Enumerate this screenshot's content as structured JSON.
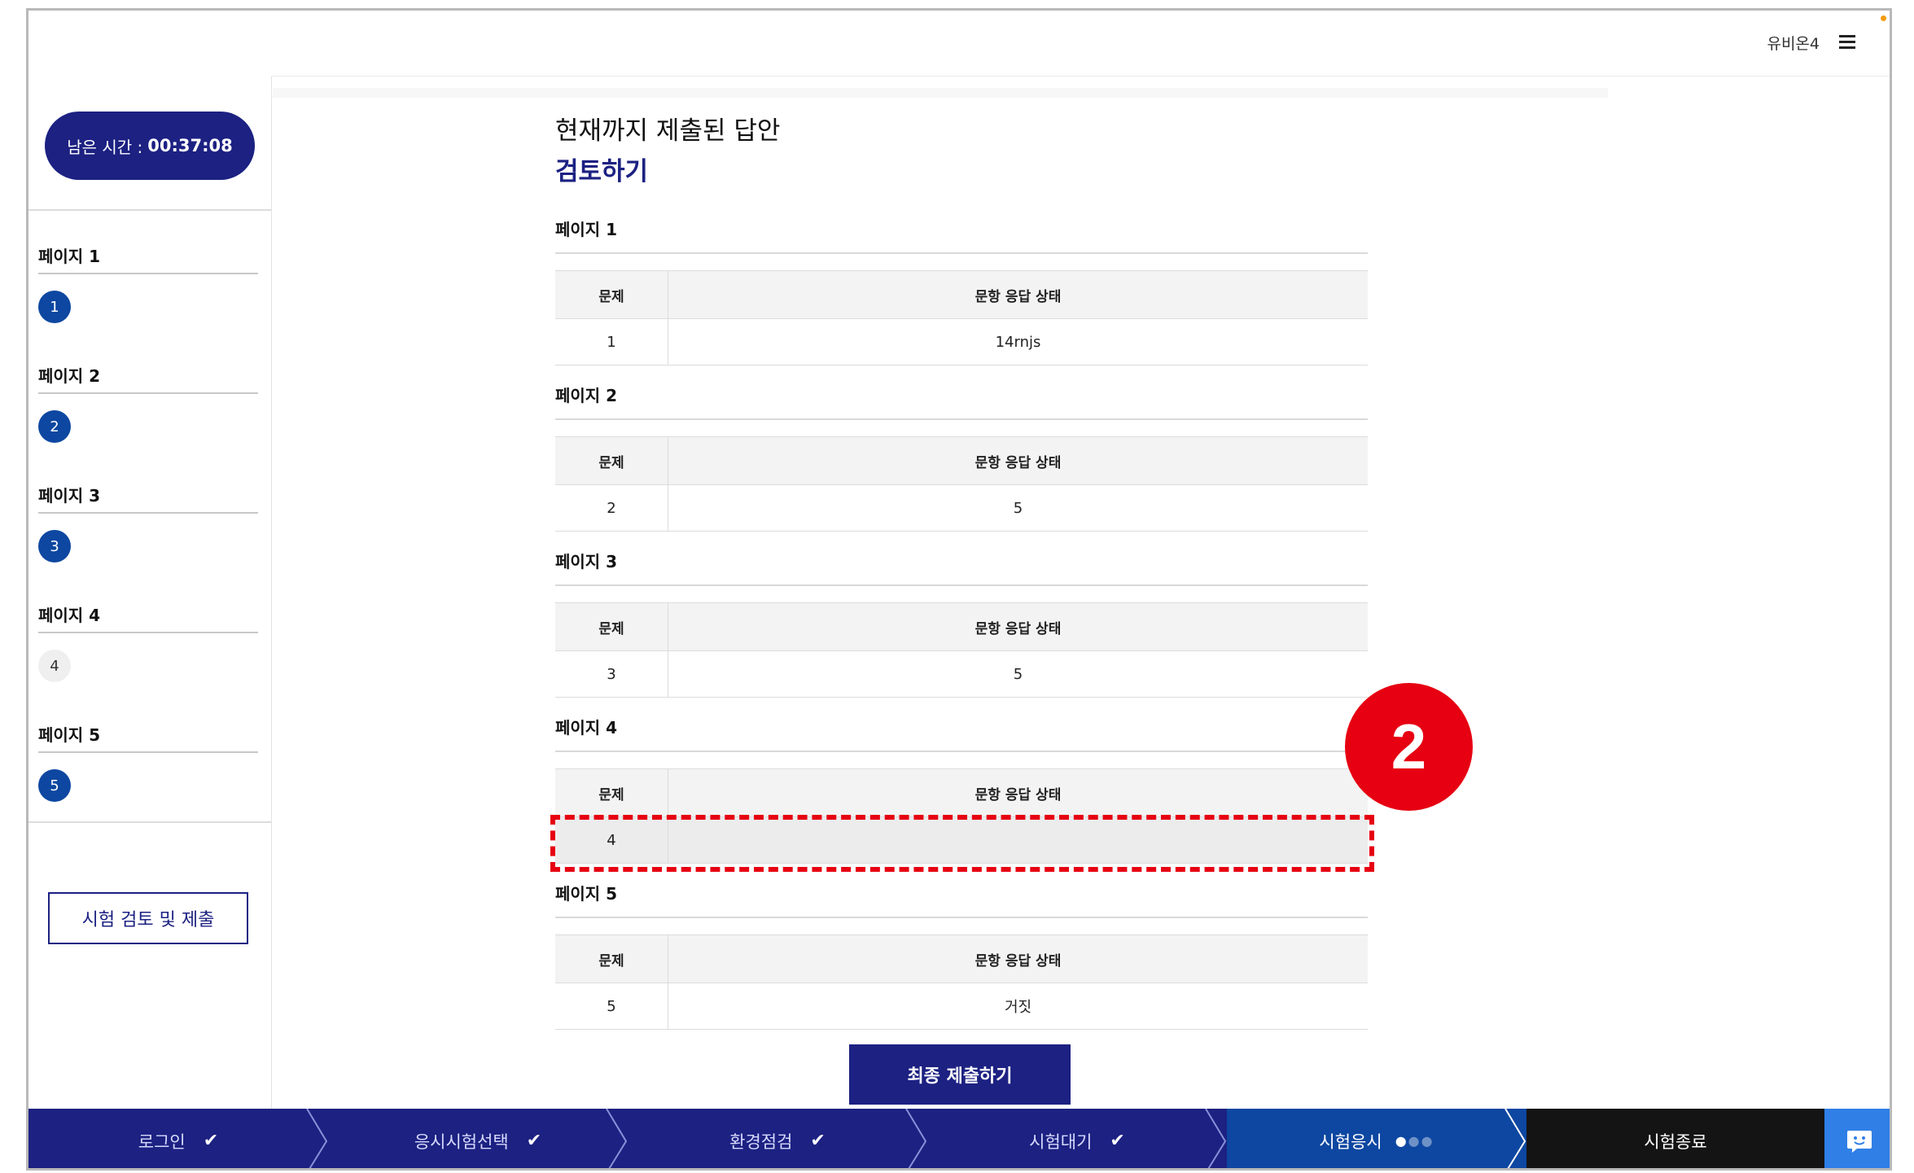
{
  "header": {
    "user_name": "유비온4"
  },
  "timer": {
    "label": "남은 시간 :",
    "value": "00:37:08"
  },
  "sidebar": {
    "pages": [
      {
        "title": "페이지 1",
        "question": "1",
        "answered": true
      },
      {
        "title": "페이지 2",
        "question": "2",
        "answered": true
      },
      {
        "title": "페이지 3",
        "question": "3",
        "answered": true
      },
      {
        "title": "페이지 4",
        "question": "4",
        "answered": false
      },
      {
        "title": "페이지 5",
        "question": "5",
        "answered": true
      }
    ],
    "review_button": "시험 검토 및 제출"
  },
  "main": {
    "heading": "현재까지 제출된 답안",
    "subheading": "검토하기",
    "col_question": "문제",
    "col_status": "문항 응답 상태",
    "sections": [
      {
        "title": "페이지 1",
        "question": "1",
        "answer": "14rnjs"
      },
      {
        "title": "페이지 2",
        "question": "2",
        "answer": "5"
      },
      {
        "title": "페이지 3",
        "question": "3",
        "answer": "5"
      },
      {
        "title": "페이지 4",
        "question": "4",
        "answer": ""
      },
      {
        "title": "페이지 5",
        "question": "5",
        "answer": "거짓"
      }
    ],
    "final_submit": "최종 제출하기"
  },
  "callout": {
    "number": "2",
    "color": "#e60012"
  },
  "steps": [
    {
      "label": "로그인",
      "state": "done"
    },
    {
      "label": "응시시험선택",
      "state": "done"
    },
    {
      "label": "환경점검",
      "state": "done"
    },
    {
      "label": "시험대기",
      "state": "done"
    },
    {
      "label": "시험응시",
      "state": "active"
    },
    {
      "label": "시험종료",
      "state": "pending"
    }
  ],
  "colors": {
    "navy": "#1c2182",
    "blue": "#0d47a1",
    "chat": "#2f7fe6"
  }
}
